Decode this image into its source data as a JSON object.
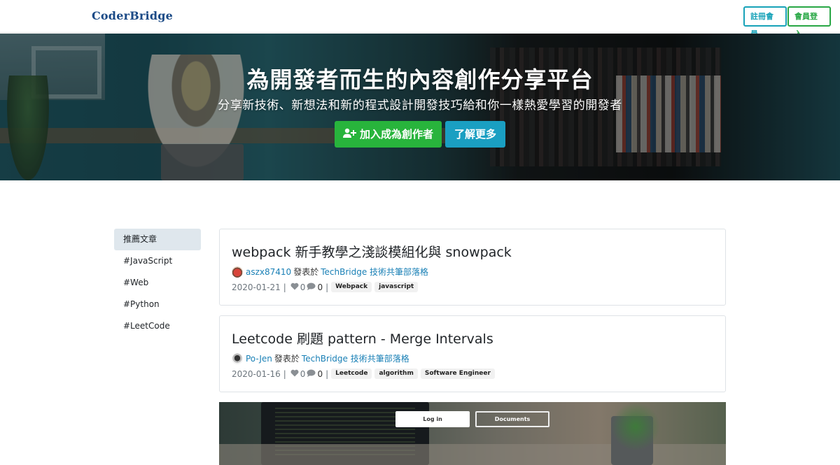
{
  "nav": {
    "brand": "CoderBridge",
    "register_label": "註冊會員",
    "login_label": "會員登入"
  },
  "hero": {
    "title": "為開發者而生的內容創作分享平台",
    "subtitle": "分享新技術、新想法和新的程式設計開發技巧給和你一樣熱愛學習的開發者",
    "join_label": "加入成為創作者",
    "more_label": "了解更多"
  },
  "sidebar": {
    "items": [
      {
        "label": "推薦文章",
        "active": true
      },
      {
        "label": "#JavaScript"
      },
      {
        "label": "#Web"
      },
      {
        "label": "#Python"
      },
      {
        "label": "#LeetCode"
      }
    ]
  },
  "posts": [
    {
      "title": "webpack 新手教學之淺談模組化與 snowpack",
      "author": "aszx87410",
      "published_in": "發表於",
      "blog": "TechBridge 技術共筆部落格",
      "date": "2020-01-21",
      "likes": "0",
      "comments": "0",
      "tags": [
        "Webpack",
        "javascript"
      ]
    },
    {
      "title": "Leetcode 刷題 pattern - Merge Intervals",
      "author": "Po-Jen",
      "published_in": "發表於",
      "blog": "TechBridge 技術共筆部落格",
      "date": "2020-01-16",
      "likes": "0",
      "comments": "0",
      "tags": [
        "Leetcode",
        "algorithm",
        "Software Engineer"
      ]
    }
  ],
  "banner": {
    "login_label": "Log in",
    "docs_label": "Documents"
  }
}
